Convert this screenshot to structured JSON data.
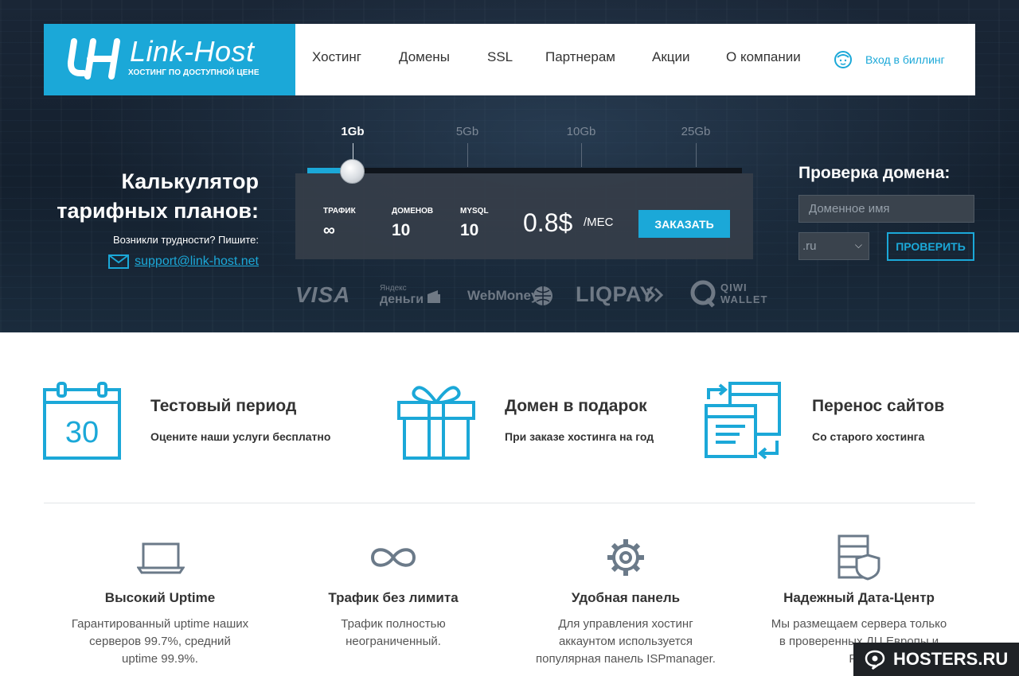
{
  "header": {
    "logo_name": "Link-Host",
    "logo_tagline": "ХОСТИНГ ПО ДОСТУПНОЙ ЦЕНЕ",
    "nav": [
      "Хостинг",
      "Домены",
      "SSL",
      "Партнерам",
      "Акции",
      "О компании"
    ],
    "billing": "Вход в биллинг"
  },
  "calculator": {
    "title_line1": "Калькулятор",
    "title_line2": "тарифных планов:",
    "help_text": "Возникли трудности? Пишите:",
    "email": "support@link-host.net",
    "ticks": [
      "1Gb",
      "5Gb",
      "10Gb",
      "25Gb"
    ],
    "selected_tick": "1Gb",
    "specs": [
      {
        "label": "ТРАФИК",
        "value": "∞"
      },
      {
        "label": "ДОМЕНОВ",
        "value": "10"
      },
      {
        "label": "MYSQL",
        "value": "10"
      }
    ],
    "price": "0.8$",
    "period": "/МЕС",
    "order_button": "ЗАКАЗАТЬ"
  },
  "payments": {
    "visa": "VISA",
    "yandex_top": "Яндекс",
    "yandex_bottom": "деньги",
    "webmoney": "WebMoney",
    "liqpay": "LIQPAY",
    "qiwi_top": "QIWI",
    "qiwi_bottom": "WALLET"
  },
  "domain_check": {
    "title": "Проверка домена:",
    "placeholder": "Доменное имя",
    "zone": ".ru",
    "button": "ПРОВЕРИТЬ"
  },
  "features": [
    {
      "title": "Тестовый период",
      "subtitle": "Оцените наши услуги бесплатно",
      "icon": "calendar-icon",
      "icon_text": "30"
    },
    {
      "title": "Домен в подарок",
      "subtitle": "При заказе хостинга на год",
      "icon": "gift-icon"
    },
    {
      "title": "Перенос сайтов",
      "subtitle": "Со старого хостинга",
      "icon": "transfer-windows-icon"
    }
  ],
  "advantages": [
    {
      "title": "Высокий Uptime",
      "lines": [
        "Гарантированный uptime наших",
        "серверов 99.7%, средний",
        "uptime 99.9%."
      ],
      "icon": "laptop-icon"
    },
    {
      "title": "Трафик без лимита",
      "lines": [
        "Трафик полностью",
        "неограниченный."
      ],
      "icon": "infinity-icon"
    },
    {
      "title": "Удобная панель",
      "lines": [
        "Для управления хостинг",
        "аккаунтом используется",
        "популярная панель ISPmanager."
      ],
      "icon": "gear-icon"
    },
    {
      "title": "Надежный Дата-Центр",
      "lines": [
        "Мы размещаем сервера только",
        "в проверенных ДЦ Европы и",
        "Рос"
      ],
      "icon": "server-shield-icon"
    }
  ],
  "watermark": "HOSTERS.RU",
  "colors": {
    "accent": "#1ba8d8",
    "icon_blue": "#1ba8d8",
    "icon_gray": "#6b7a89",
    "text_dark": "#333333"
  }
}
